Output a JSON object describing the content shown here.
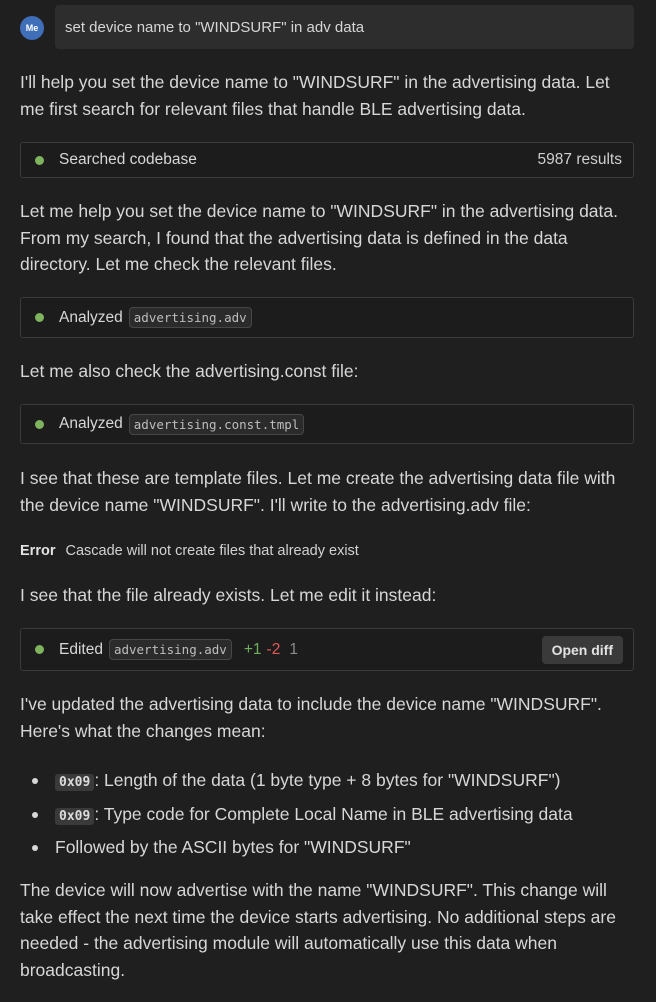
{
  "user": {
    "avatar": "Me",
    "message": "set device name to \"WINDSURF\" in adv data"
  },
  "messages": {
    "p1": "I'll help you set the device name to \"WINDSURF\" in the advertising data. Let me first search for relevant files that handle BLE advertising data.",
    "p2": "Let me help you set the device name to \"WINDSURF\" in the advertising data. From my search, I found that the advertising data is defined in the data directory. Let me check the relevant files.",
    "p3": "Let me also check the advertising.const file:",
    "p4": "I see that these are template files. Let me create the advertising data file with the device name \"WINDSURF\". I'll write to the advertising.adv file:",
    "p5": "I see that the file already exists. Let me edit it instead:",
    "p6": "I've updated the advertising data to include the device name \"WINDSURF\". Here's what the changes mean:",
    "p7": "The device will now advertise with the name \"WINDSURF\". This change will take effect the next time the device starts advertising. No additional steps are needed - the advertising module will automatically use this data when broadcasting."
  },
  "search_step": {
    "label": "Searched codebase",
    "count": "5987 results"
  },
  "analyze1": {
    "label": "Analyzed",
    "file": "advertising.adv"
  },
  "analyze2": {
    "label": "Analyzed",
    "file": "advertising.const.tmpl"
  },
  "error": {
    "label": "Error",
    "text": "Cascade will not create files that already exist"
  },
  "edit_step": {
    "label": "Edited",
    "file": "advertising.adv",
    "added": "+1",
    "removed": "-2",
    "changed": "1",
    "open_diff": "Open diff"
  },
  "bullets": [
    {
      "code": "0x09",
      "text": ": Length of the data (1 byte type + 8 bytes for \"WINDSURF\")"
    },
    {
      "code": "0x09",
      "text": ": Type code for Complete Local Name in BLE advertising data"
    },
    {
      "code": "",
      "text": "Followed by the ASCII bytes for \"WINDSURF\""
    }
  ],
  "colors": {
    "success_dot": "#7fb35e",
    "added": "#6fae5a",
    "removed": "#e05a5a",
    "avatar": "#3f6fb8"
  }
}
